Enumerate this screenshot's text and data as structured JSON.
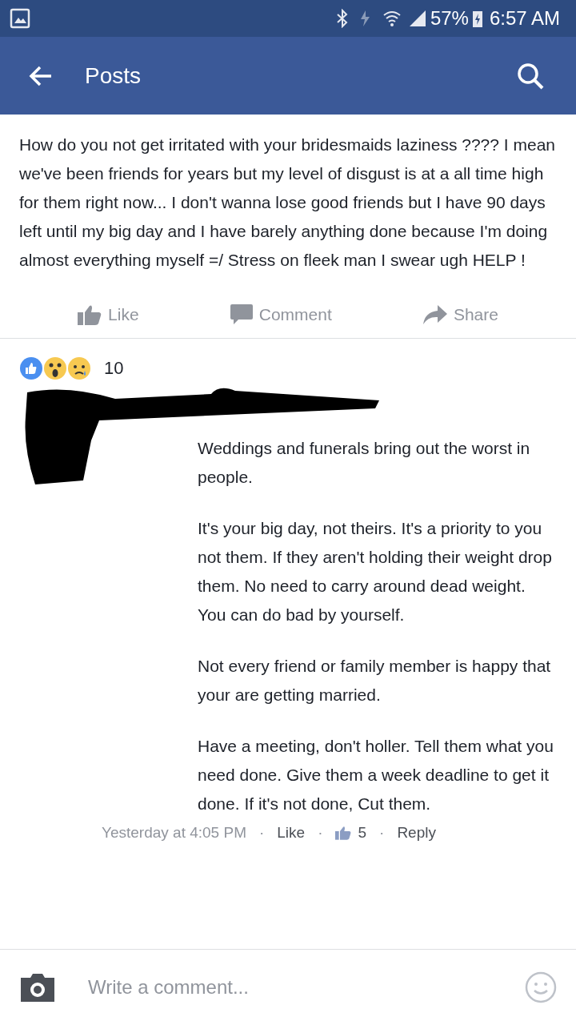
{
  "status_bar": {
    "battery": "57%",
    "time": "6:57 AM"
  },
  "app_bar": {
    "title": "Posts"
  },
  "post": {
    "text": "How do you not get irritated with your bridesmaids laziness ???? I mean we've been friends for years but my level of disgust is at a all time high for them right now... I don't wanna lose good friends but I have  90 days left until my big day and I have barely anything done because I'm doing almost everything myself =/ Stress on fleek man I swear ugh HELP !",
    "actions": [
      {
        "kind": "like",
        "label": "Like"
      },
      {
        "kind": "comment",
        "label": "Comment"
      },
      {
        "kind": "share",
        "label": "Share"
      }
    ],
    "reaction_count": "10"
  },
  "comment": {
    "paragraphs": [
      "Weddings and funerals bring out the worst in people.",
      "It's your big day, not theirs.  It's a priority to you not them. If they aren't  holding their weight drop them. No need to carry around dead weight.  You can do bad by yourself.",
      "Not every  friend or family  member is happy that your are getting married.",
      "Have a meeting, don't holler. Tell them what you need done.  Give them a week deadline  to get it done. If it's not done,  Cut them."
    ],
    "time": "Yesterday at 4:05 PM",
    "separator": "·",
    "like": "Like",
    "like_count": "5",
    "reply": "Reply"
  },
  "composer": {
    "placeholder": "Write a comment..."
  }
}
